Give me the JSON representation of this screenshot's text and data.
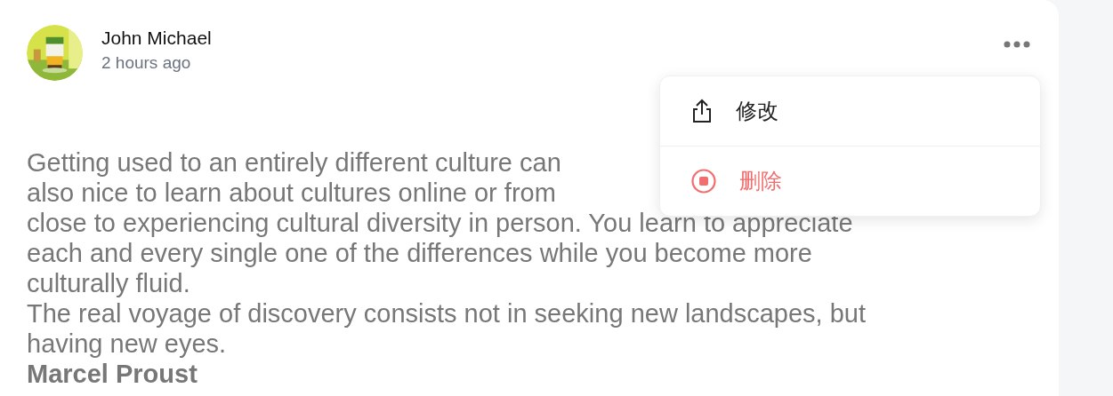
{
  "post": {
    "author": "John Michael",
    "time": "2 hours ago",
    "lines": [
      "Getting used to an entirely different culture can",
      "also nice to learn about cultures online or from",
      "close to experiencing cultural diversity in person. You learn to appreciate",
      "each and every single one of the differences while you become more",
      "culturally fluid.",
      "The real voyage of discovery consists not in seeking new landscapes, but",
      "having new eyes."
    ],
    "signature": "Marcel Proust"
  },
  "menu": {
    "items": [
      {
        "label": "修改",
        "kind": "share"
      },
      {
        "label": "删除",
        "kind": "stop"
      }
    ]
  }
}
